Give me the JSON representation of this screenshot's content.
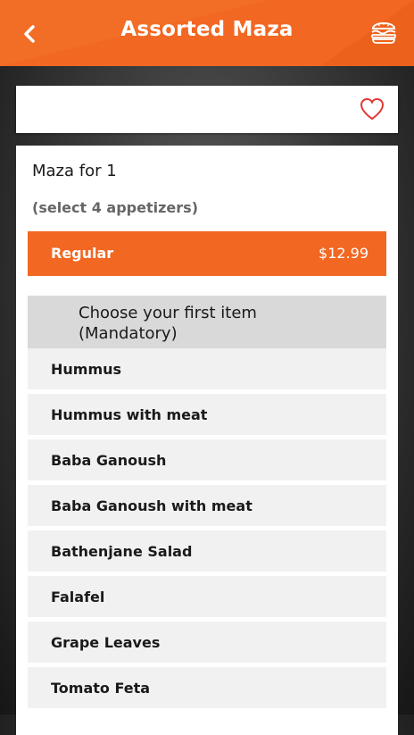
{
  "header": {
    "title": "Assorted Maza",
    "back_icon": "chevron-left-icon",
    "cart_icon": "burger-icon",
    "accent_color": "#f26722"
  },
  "favorite": {
    "icon": "heart-outline-icon",
    "color": "#e53935"
  },
  "product": {
    "name": "Maza for 1",
    "description": "(select 4 appetizers)",
    "size": {
      "label": "Regular",
      "price": "$12.99"
    }
  },
  "group": {
    "title": "Choose your first item (Mandatory)",
    "options": [
      {
        "label": "Hummus"
      },
      {
        "label": "Hummus with meat"
      },
      {
        "label": "Baba Ganoush"
      },
      {
        "label": "Baba Ganoush with meat"
      },
      {
        "label": "Bathenjane Salad"
      },
      {
        "label": "Falafel"
      },
      {
        "label": "Grape Leaves"
      },
      {
        "label": "Tomato Feta"
      }
    ]
  }
}
